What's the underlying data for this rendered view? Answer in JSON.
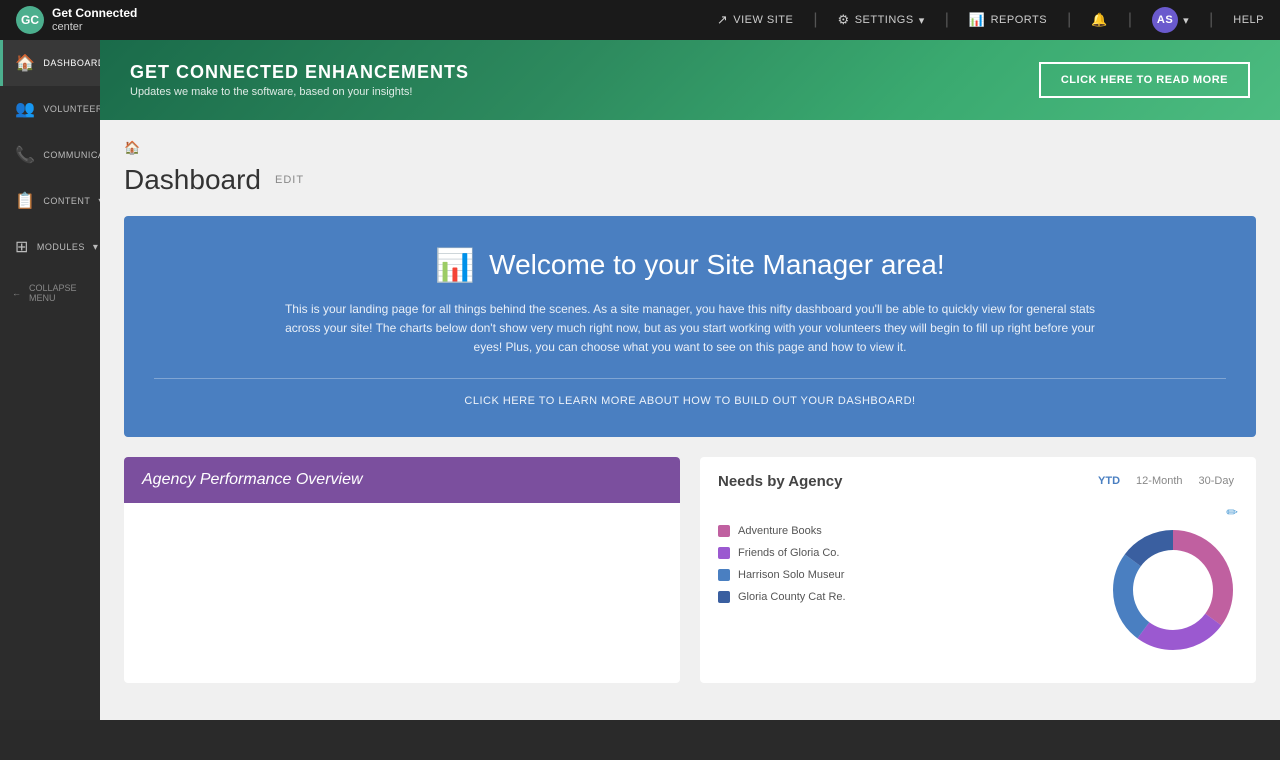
{
  "topbar": {
    "logo_icon": "GC",
    "logo_line1": "Get Connected",
    "logo_line2": "center",
    "nav_items": [
      {
        "id": "view-site",
        "icon": "↗",
        "label": "VIEW SITE"
      },
      {
        "id": "settings",
        "icon": "⚙",
        "label": "SETTINGS",
        "has_arrow": true
      },
      {
        "id": "reports",
        "icon": "📊",
        "label": "REPORTS"
      },
      {
        "id": "notifications",
        "icon": "🔔",
        "label": ""
      },
      {
        "id": "user",
        "avatar": "AS",
        "has_arrow": true
      },
      {
        "id": "help",
        "label": "HELP"
      }
    ]
  },
  "sidebar": {
    "items": [
      {
        "id": "dashboard",
        "icon": "🏠",
        "label": "DASHBOARD",
        "active": true
      },
      {
        "id": "volunteerism",
        "icon": "👥",
        "label": "VOLUNTEERISM",
        "has_arrow": true
      },
      {
        "id": "communication",
        "icon": "📞",
        "label": "COMMUNICATION",
        "has_arrow": true
      },
      {
        "id": "content",
        "icon": "📋",
        "label": "CONTENT",
        "has_arrow": true
      },
      {
        "id": "modules",
        "icon": "⊞",
        "label": "MODULES",
        "has_arrow": true
      }
    ],
    "collapse_label": "COLLAPSE MENU"
  },
  "banner": {
    "title": "GET CONNECTED ENHANCEMENTS",
    "subtitle": "Updates we make to the software, based on your insights!",
    "button_label": "CLICK HERE TO READ MORE"
  },
  "breadcrumb": "🏠",
  "page_title": "Dashboard",
  "edit_label": "EDIT",
  "welcome": {
    "icon": "📊",
    "title": "Welcome to your Site Manager area!",
    "body": "This is your landing page for all things behind the scenes. As a site manager, you have this nifty dashboard you'll be able to quickly view for general stats across your site! The charts below don't show very much right now, but as you start working with your volunteers they will begin to fill up right before your eyes! Plus, you can choose what you want to see on this page and how to view it.",
    "link_label": "CLICK HERE TO LEARN MORE ABOUT HOW TO BUILD OUT YOUR DASHBOARD!"
  },
  "agency_performance": {
    "title": "Agency Performance Overview"
  },
  "needs_by_agency": {
    "title": "Needs by Agency",
    "tabs": [
      {
        "id": "ytd",
        "label": "YTD",
        "active": true
      },
      {
        "id": "12month",
        "label": "12-Month"
      },
      {
        "id": "30day",
        "label": "30-Day"
      }
    ],
    "legend": [
      {
        "id": "adventure-books",
        "label": "Adventure Books",
        "color": "#c060a0"
      },
      {
        "id": "friends-gloria",
        "label": "Friends of Gloria Co.",
        "color": "#9b59d0"
      },
      {
        "id": "harrison-solo",
        "label": "Harrison Solo Museur",
        "color": "#4a7fc1"
      },
      {
        "id": "gloria-county",
        "label": "Gloria County Cat Re.",
        "color": "#3a5fa0"
      }
    ],
    "chart_segments": [
      {
        "label": "Adventure Books",
        "value": 35,
        "color": "#c060a0"
      },
      {
        "label": "Friends of Gloria Co.",
        "value": 25,
        "color": "#9b59d0"
      },
      {
        "label": "Harrison Solo Museur",
        "value": 25,
        "color": "#4a7fc1"
      },
      {
        "label": "Gloria County Cat Re.",
        "value": 15,
        "color": "#3a5fa0"
      }
    ]
  }
}
